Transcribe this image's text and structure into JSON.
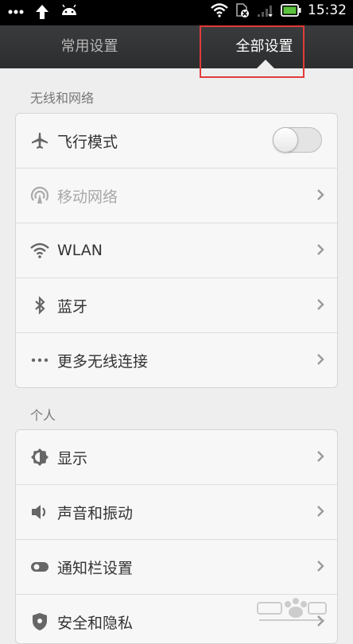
{
  "status_bar": {
    "time": "15:32"
  },
  "tabs": [
    {
      "label": "常用设置",
      "active": false
    },
    {
      "label": "全部设置",
      "active": true
    }
  ],
  "colors": {
    "highlight": "#e03c3c"
  },
  "sections": [
    {
      "title": "无线和网络",
      "items": [
        {
          "label": "飞行模式",
          "icon": "airplane-icon",
          "toggle": false
        },
        {
          "label": "移动网络",
          "icon": "mobile-network-icon",
          "disabled": true
        },
        {
          "label": "WLAN",
          "icon": "wifi-icon"
        },
        {
          "label": "蓝牙",
          "icon": "bluetooth-icon"
        },
        {
          "label": "更多无线连接",
          "icon": "more-icon"
        }
      ]
    },
    {
      "title": "个人",
      "items": [
        {
          "label": "显示",
          "icon": "display-icon"
        },
        {
          "label": "声音和振动",
          "icon": "sound-icon"
        },
        {
          "label": "通知栏设置",
          "icon": "notification-icon"
        },
        {
          "label": "安全和隐私",
          "icon": "security-icon"
        }
      ]
    }
  ]
}
